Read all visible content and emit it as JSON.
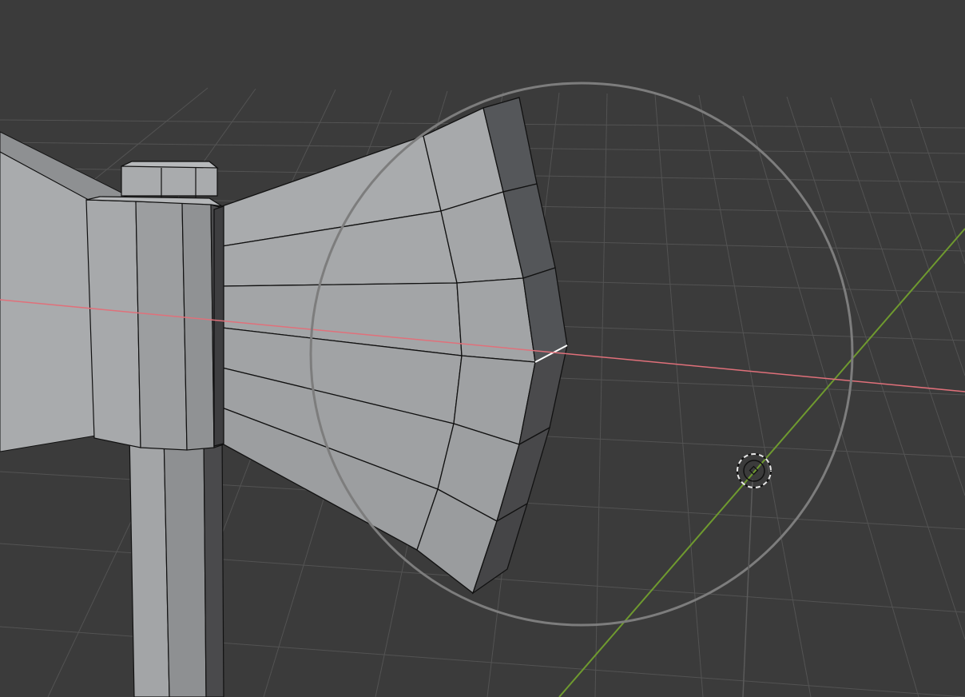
{
  "viewport": {
    "mode": "edit-mode",
    "background_color": "#3b3b3b",
    "grid_color": "#525252",
    "x_axis_color": "#e0707a",
    "y_axis_color": "#6f9a2f",
    "mesh_face_light": "#a9abad",
    "mesh_face_side": "#8e9092",
    "mesh_face_dark": "#4a4a4c",
    "wire_color": "#111111",
    "selected_edge_color": "#ffffff",
    "brush_circle_color": "#7d7d7d"
  },
  "icons": {
    "cursor": "3d-cursor-icon",
    "brush": "brush-radius-circle"
  }
}
